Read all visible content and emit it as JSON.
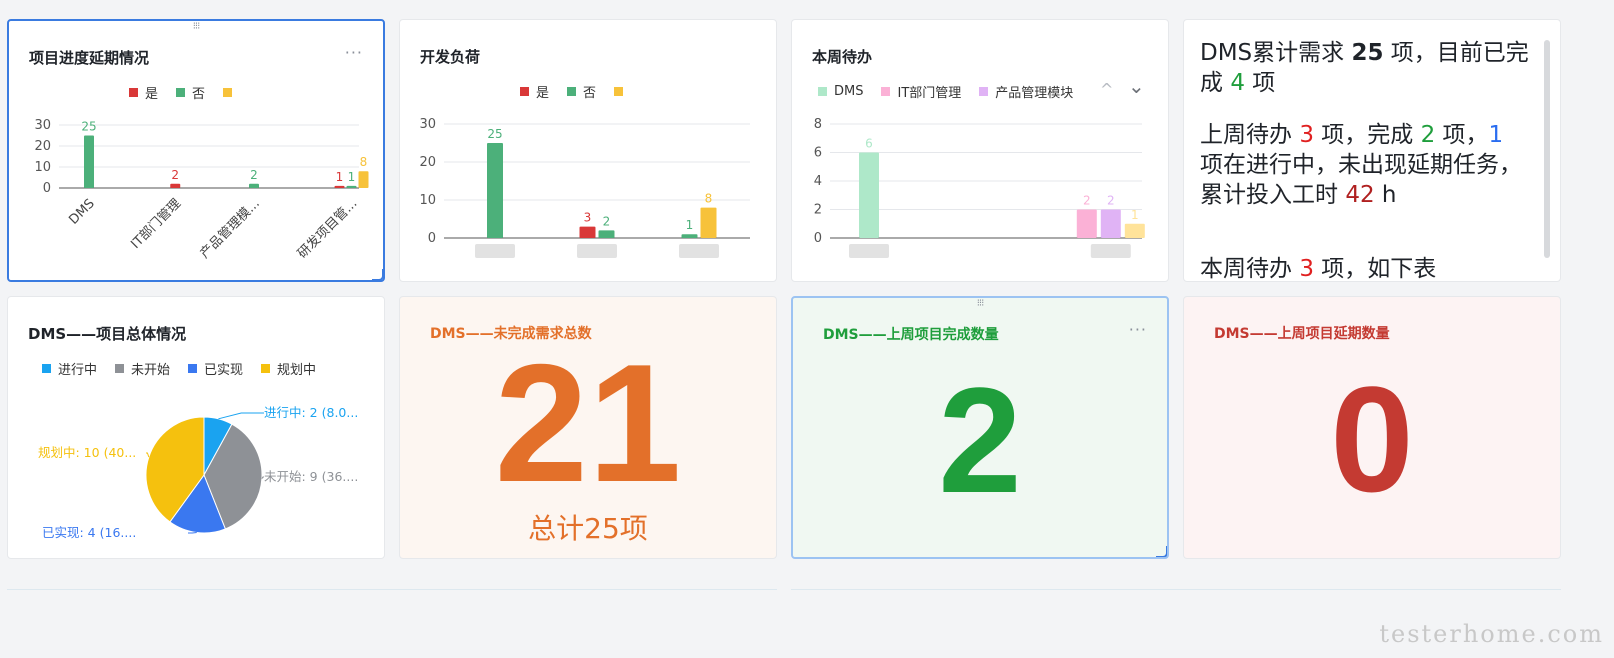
{
  "colors": {
    "yes": "#d93838",
    "no": "#4cb07a",
    "third": "#f7c23a",
    "dms": "#aee8c9",
    "it": "#fbb1d6",
    "product": "#e0b3f5",
    "in_progress": "#1aa3f0",
    "not_started": "#8e9196",
    "done": "#3a78f0",
    "planning": "#f5c10e",
    "orange": "#e3702a",
    "green": "#1f9e3c",
    "red": "#c43a32"
  },
  "cards": {
    "delay": {
      "title": "项目进度延期情况",
      "more": "···",
      "legend": [
        {
          "label": "是",
          "color": "#d93838"
        },
        {
          "label": "否",
          "color": "#4cb07a"
        },
        {
          "label": "",
          "color": "#f7c23a"
        }
      ]
    },
    "load": {
      "title": "开发负荷",
      "legend": [
        {
          "label": "是",
          "color": "#d93838"
        },
        {
          "label": "否",
          "color": "#4cb07a"
        },
        {
          "label": "",
          "color": "#f7c23a"
        }
      ]
    },
    "todo": {
      "title": "本周待办",
      "legend": [
        {
          "label": "DMS",
          "color": "#aee8c9"
        },
        {
          "label": "IT部门管理",
          "color": "#fbb1d6"
        },
        {
          "label": "产品管理模块",
          "color": "#e0b3f5"
        }
      ],
      "up_icon": "^",
      "down_icon": "⌄"
    },
    "summary": {
      "p1": [
        {
          "t": "DMS累计需求 ",
          "c": "#1f2329",
          "b": false
        },
        {
          "t": "25",
          "c": "#1f2329",
          "b": true
        },
        {
          "t": " 项，目前已完成 ",
          "c": "#1f2329",
          "b": false
        },
        {
          "t": "4",
          "c": "#1f9e3c",
          "b": false
        },
        {
          "t": " 项",
          "c": "#1f2329",
          "b": false
        }
      ],
      "p2": [
        {
          "t": "上周待办 ",
          "c": "#1f2329",
          "b": false
        },
        {
          "t": "3",
          "c": "#e02020",
          "b": false
        },
        {
          "t": " 项，完成 ",
          "c": "#1f2329",
          "b": false
        },
        {
          "t": "2",
          "c": "#1f9e3c",
          "b": false
        },
        {
          "t": " 项，",
          "c": "#1f2329",
          "b": false
        },
        {
          "t": "1",
          "c": "#2a6df0",
          "b": false
        },
        {
          "t": " 项在进行中，未出现延期任务，累计投入工时 ",
          "c": "#1f2329",
          "b": false
        },
        {
          "t": "42",
          "c": "#b02020",
          "b": false
        },
        {
          "t": " h",
          "c": "#1f2329",
          "b": false
        }
      ],
      "p3": [
        {
          "t": "本周待办 ",
          "c": "#1f2329",
          "b": false
        },
        {
          "t": "3",
          "c": "#e02020",
          "b": false
        },
        {
          "t": " 项，如下表",
          "c": "#1f2329",
          "b": false
        }
      ]
    },
    "overall": {
      "title": "DMS——项目总体情况",
      "legend": [
        {
          "label": "进行中",
          "color": "#1aa3f0"
        },
        {
          "label": "未开始",
          "color": "#8e9196"
        },
        {
          "label": "已实现",
          "color": "#3a78f0"
        },
        {
          "label": "规划中",
          "color": "#f5c10e"
        }
      ]
    },
    "unfinished": {
      "title": "DMS——未完成需求总数",
      "value": "21",
      "total": "总计25项"
    },
    "lastweek_done": {
      "title": "DMS——上周项目完成数量",
      "value": "2",
      "more": "···"
    },
    "lastweek_delay": {
      "title": "DMS——上周项目延期数量",
      "value": "0"
    }
  },
  "chart_data": [
    {
      "type": "bar",
      "title": "项目进度延期情况",
      "categories": [
        "DMS",
        "IT部门管理",
        "产品管理模...",
        "研发项目管..."
      ],
      "yticks": [
        "0",
        "10",
        "20",
        "30"
      ],
      "ylim": [
        0,
        30
      ],
      "series": [
        {
          "name": "是",
          "values": [
            null,
            2,
            null,
            1
          ]
        },
        {
          "name": "否",
          "values": [
            25,
            null,
            2,
            1
          ]
        },
        {
          "name": "",
          "values": [
            null,
            null,
            null,
            8
          ]
        }
      ]
    },
    {
      "type": "bar",
      "title": "开发负荷",
      "categories": [
        "",
        "",
        ""
      ],
      "yticks": [
        "0",
        "10",
        "20",
        "30"
      ],
      "ylim": [
        0,
        30
      ],
      "series": [
        {
          "name": "是",
          "values": [
            null,
            3,
            null
          ]
        },
        {
          "name": "否",
          "values": [
            25,
            2,
            1
          ]
        },
        {
          "name": "",
          "values": [
            null,
            null,
            8
          ]
        }
      ]
    },
    {
      "type": "bar",
      "title": "本周待办",
      "categories": [
        "",
        ""
      ],
      "yticks": [
        "0",
        "2",
        "4",
        "6",
        "8"
      ],
      "ylim": [
        0,
        8
      ],
      "series": [
        {
          "name": "DMS",
          "values": [
            6,
            null
          ]
        },
        {
          "name": "IT部门管理",
          "values": [
            null,
            2
          ]
        },
        {
          "name": "产品管理模块",
          "values": [
            null,
            2
          ]
        },
        {
          "name": "",
          "values": [
            null,
            1
          ]
        }
      ]
    },
    {
      "type": "pie",
      "title": "DMS——项目总体情况",
      "slices": [
        {
          "name": "进行中",
          "value": 2,
          "label": "进行中: 2 (8.0..."
        },
        {
          "name": "未开始",
          "value": 9,
          "label": "未开始: 9 (36...."
        },
        {
          "name": "已实现",
          "value": 4,
          "label": "已实现: 4 (16...."
        },
        {
          "name": "规划中",
          "value": 10,
          "label": "规划中: 10 (40..."
        }
      ]
    }
  ],
  "watermark": "testerhome.com"
}
